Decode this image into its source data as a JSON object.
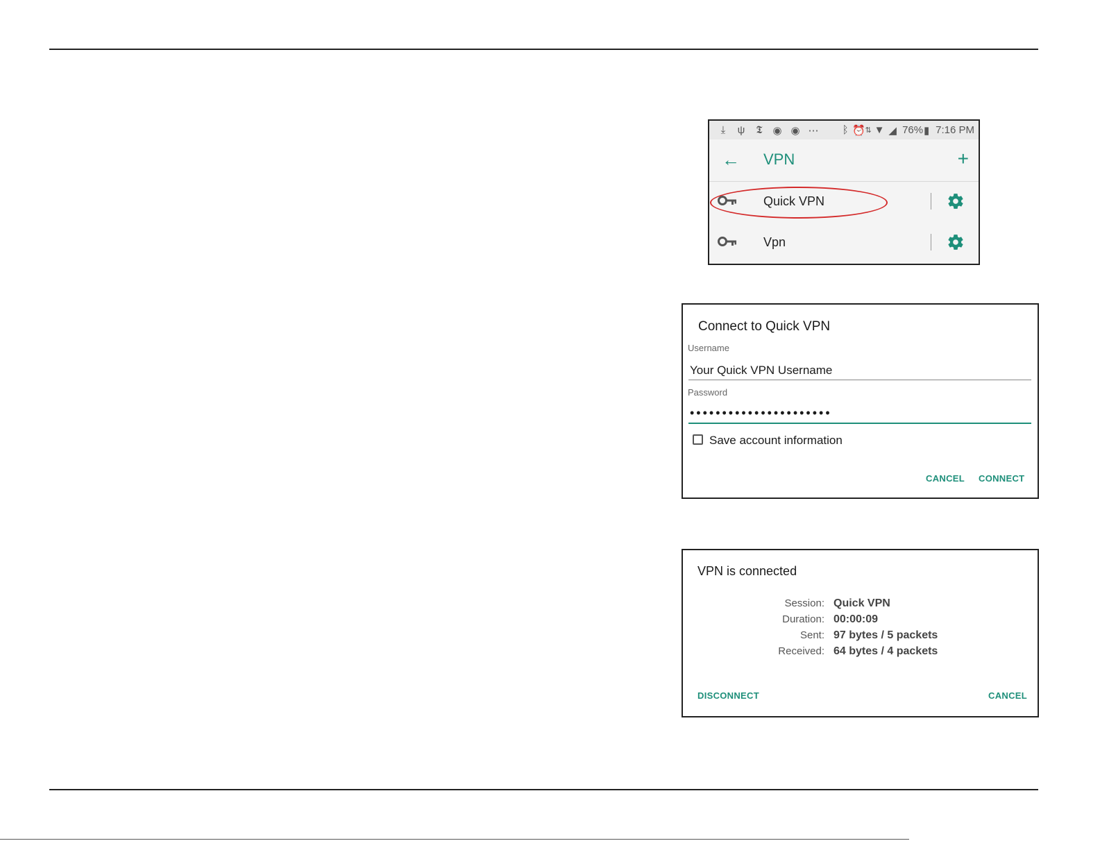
{
  "vpn_list": {
    "status_bar": {
      "icons": [
        "download-icon",
        "usb-icon",
        "nyt-icon",
        "chrome-icon",
        "chrome-icon",
        "more-icon",
        "bluetooth-icon",
        "alarm-icon",
        "data-icon",
        "wifi-icon",
        "signal-icon",
        "battery-icon"
      ],
      "battery": "76%",
      "time": "7:16 PM"
    },
    "app_bar": {
      "title": "VPN"
    },
    "items": [
      {
        "label": "Quick VPN"
      },
      {
        "label": "Vpn"
      }
    ],
    "accent_color": "#1e8f7a",
    "highlight_color": "#d42a2a"
  },
  "connect_dialog": {
    "title": "Connect to Quick VPN",
    "username_label": "Username",
    "username_value": "Your Quick VPN Username",
    "password_label": "Password",
    "password_value": "••••••••••••••••••••••",
    "save_label": "Save account information",
    "save_checked": false,
    "cancel_label": "CANCEL",
    "connect_label": "CONNECT"
  },
  "connected_dialog": {
    "title": "VPN is connected",
    "rows": [
      {
        "key": "Session:",
        "value": "Quick VPN"
      },
      {
        "key": "Duration:",
        "value": "00:00:09"
      },
      {
        "key": "Sent:",
        "value": "97 bytes / 5 packets"
      },
      {
        "key": "Received:",
        "value": "64 bytes / 4 packets"
      }
    ],
    "disconnect_label": "DISCONNECT",
    "cancel_label": "CANCEL"
  }
}
